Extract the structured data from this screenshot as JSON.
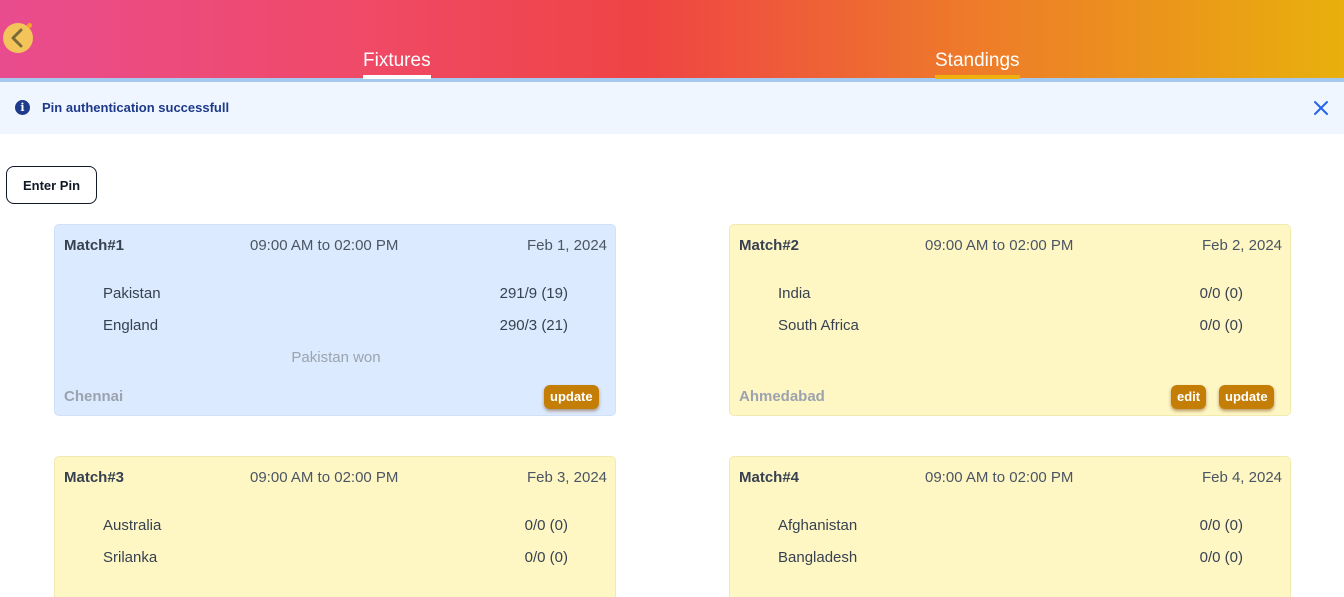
{
  "header": {
    "tabs": [
      {
        "label": "Fixtures",
        "active": true
      },
      {
        "label": "Standings",
        "active": false
      }
    ]
  },
  "alert": {
    "message": "Pin authentication successfull"
  },
  "pin_button": {
    "label": "Enter Pin"
  },
  "matches": [
    {
      "title": "Match#1",
      "time": "09:00 AM to 02:00 PM",
      "date": "Feb 1, 2024",
      "team1": "Pakistan",
      "score1": "291/9 (19)",
      "team2": "England",
      "score2": "290/3 (21)",
      "result": "Pakistan won",
      "venue": "Chennai",
      "edit_label": "",
      "update_label": "update"
    },
    {
      "title": "Match#2",
      "time": "09:00 AM to 02:00 PM",
      "date": "Feb 2, 2024",
      "team1": "India",
      "score1": "0/0 (0)",
      "team2": "South Africa",
      "score2": "0/0 (0)",
      "result": "",
      "venue": "Ahmedabad",
      "edit_label": "edit",
      "update_label": "update"
    },
    {
      "title": "Match#3",
      "time": "09:00 AM to 02:00 PM",
      "date": "Feb 3, 2024",
      "team1": "Australia",
      "score1": "0/0 (0)",
      "team2": "Srilanka",
      "score2": "0/0 (0)",
      "result": "",
      "venue": "",
      "edit_label": "",
      "update_label": ""
    },
    {
      "title": "Match#4",
      "time": "09:00 AM to 02:00 PM",
      "date": "Feb 4, 2024",
      "team1": "Afghanistan",
      "score1": "0/0 (0)",
      "team2": "Bangladesh",
      "score2": "0/0 (0)",
      "result": "",
      "venue": "",
      "edit_label": "",
      "update_label": ""
    }
  ]
}
